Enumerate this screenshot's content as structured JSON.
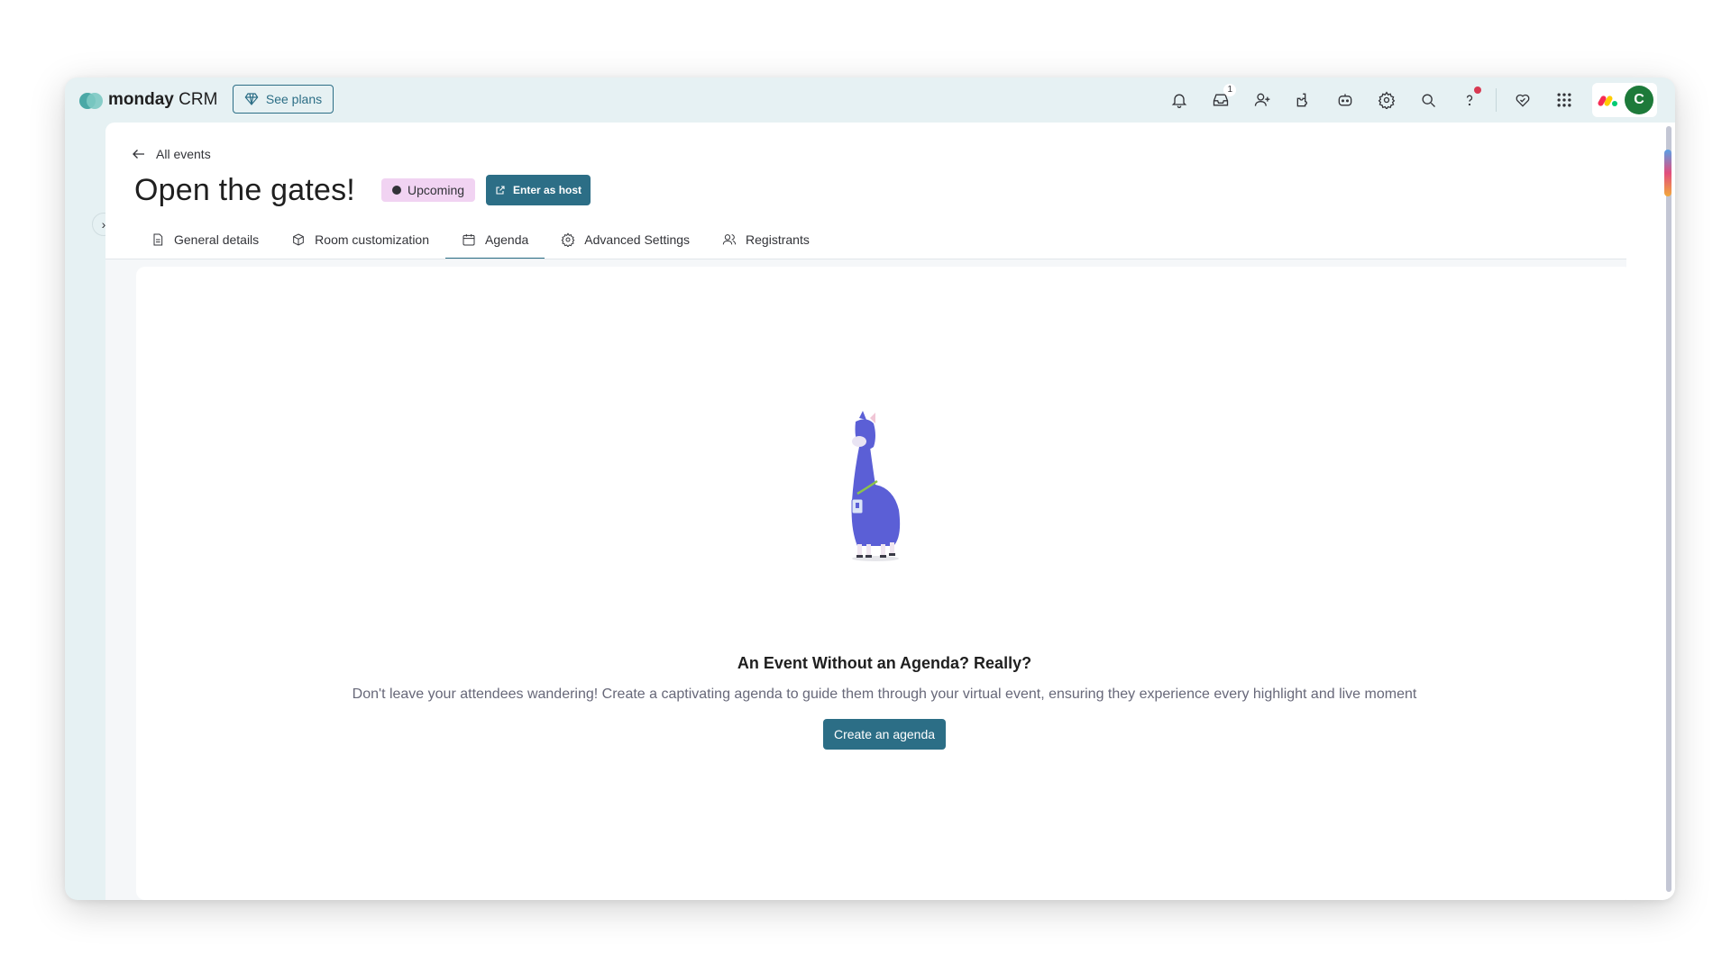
{
  "app": {
    "brand_bold": "monday",
    "brand_rest": " CRM",
    "see_plans": "See plans"
  },
  "topbar": {
    "inbox_count": "1",
    "avatar_initial": "C",
    "icons": [
      "bell-icon",
      "inbox-icon",
      "invite-icon",
      "apps-icon",
      "ai-icon",
      "gear-icon",
      "search-icon",
      "help-icon",
      "heart-icon",
      "grid-icon"
    ]
  },
  "page": {
    "back_label": "All events",
    "title": "Open the gates!",
    "status": "Upcoming",
    "enter_host": "Enter as host"
  },
  "tabs": [
    {
      "label": "General details",
      "icon": "document-icon"
    },
    {
      "label": "Room customization",
      "icon": "cube-icon"
    },
    {
      "label": "Agenda",
      "icon": "calendar-icon",
      "active": true
    },
    {
      "label": "Advanced Settings",
      "icon": "settings-icon"
    },
    {
      "label": "Registrants",
      "icon": "users-icon"
    }
  ],
  "empty": {
    "title": "An Event Without an Agenda? Really?",
    "description": "Don't leave your attendees wandering! Create a captivating agenda to guide them through your virtual event, ensuring they experience every highlight and live moment",
    "button": "Create an agenda"
  },
  "colors": {
    "primary": "#2c6e86",
    "status_bg": "#f1d3f2",
    "avatar_bg": "#1d7a3a",
    "llama": "#5b5fd6"
  }
}
